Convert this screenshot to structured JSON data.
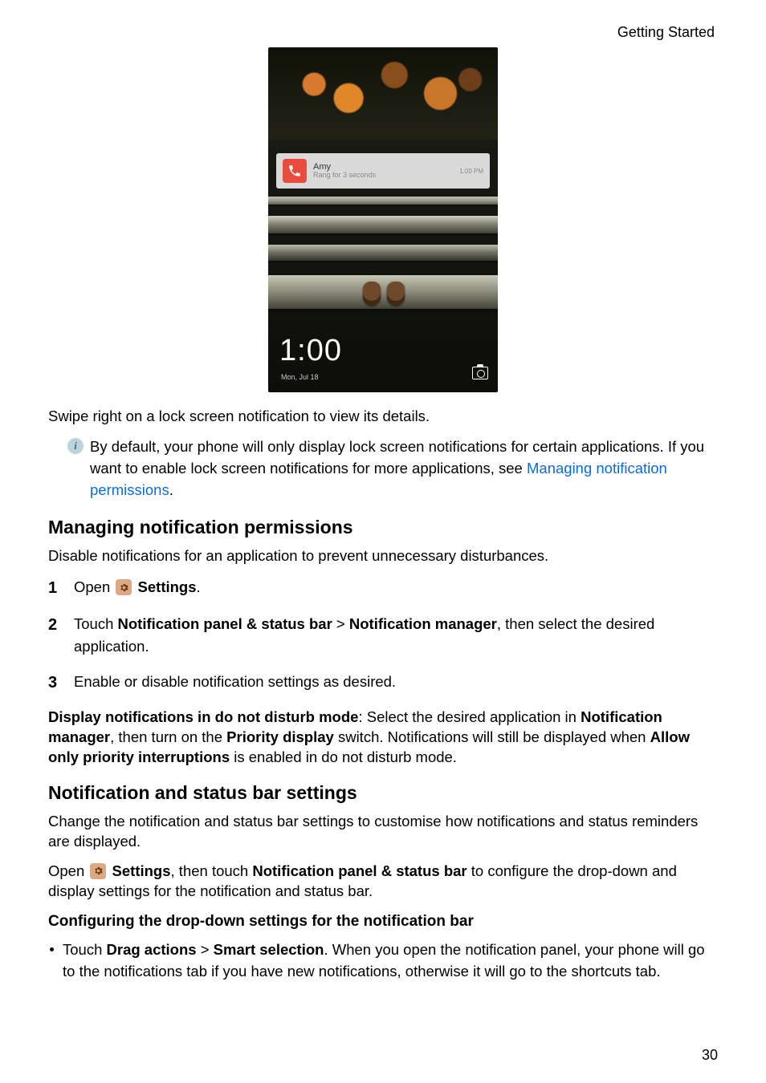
{
  "header": {
    "section": "Getting Started"
  },
  "hero": {
    "notification": {
      "name": "Amy",
      "subtitle": "Rang for 3 seconds",
      "time": "1:00 PM"
    },
    "clock": "1:00",
    "date": "Mon, Jul 18"
  },
  "intro_after_image": "Swipe right on a lock screen notification to view its details.",
  "info_box": {
    "line1": "By default, your phone will only display lock screen notifications for certain applications. If you want to enable lock screen notifications for more applications, see ",
    "link": "Managing notification permissions",
    "after_link": "."
  },
  "section1": {
    "heading": "Managing notification permissions",
    "intro": "Disable notifications for an application to prevent unnecessary disturbances.",
    "steps": [
      {
        "n": "1",
        "pre": "Open ",
        "bold_after_icon": "Settings",
        "post": "."
      },
      {
        "n": "2",
        "pre": "Touch ",
        "b1": "Notification panel & status bar",
        "mid1": " > ",
        "b2": "Notification manager",
        "post": ", then select the desired application."
      },
      {
        "n": "3",
        "text": "Enable or disable notification settings as desired."
      }
    ],
    "display_note": {
      "b1": "Display notifications in do not disturb mode",
      "t1": ": Select the desired application in ",
      "b2": "Notification manager",
      "t2": ", then turn on the ",
      "b3": "Priority display",
      "t3": " switch. Notifications will still be displayed when ",
      "b4": "Allow only priority interruptions",
      "t4": " is enabled in do not disturb mode."
    }
  },
  "section2": {
    "heading": "Notification and status bar settings",
    "intro": "Change the notification and status bar settings to customise how notifications and status reminders are displayed.",
    "open_line": {
      "pre": "Open ",
      "b1": "Settings",
      "mid1": ", then touch ",
      "b2": "Notification panel & status bar",
      "post": " to configure the drop-down and display settings for the notification and status bar."
    },
    "sub_heading": "Configuring the drop-down settings for the notification bar",
    "bullet1": {
      "pre": "Touch ",
      "b1": "Drag actions",
      "mid1": " > ",
      "b2": "Smart selection",
      "post": ". When you open the notification panel, your phone will go to the notifications tab if you have new notifications, otherwise it will go to the shortcuts tab."
    }
  },
  "page_number": "30"
}
